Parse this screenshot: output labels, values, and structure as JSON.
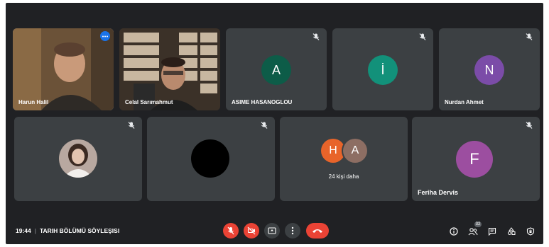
{
  "participants": [
    {
      "name": "Harun Halil",
      "type": "video"
    },
    {
      "name": "Celal Sarımahmut",
      "type": "video"
    },
    {
      "name": "ASIME HASANOGLOU",
      "initial": "A",
      "color": "#0d5c48"
    },
    {
      "name": "",
      "initial": "İ",
      "color": "#12917a"
    },
    {
      "name": "Nurdan Ahmet",
      "initial": "N",
      "color": "#7b4ca8"
    },
    {
      "name": "",
      "type": "photo"
    },
    {
      "name": "",
      "type": "black"
    },
    {
      "name": "Feriha Dervis",
      "initial": "F",
      "color": "#9c4ea0"
    }
  ],
  "more_tile": {
    "label": "24 kişi daha",
    "avatars": [
      {
        "initial": "H",
        "color": "#e8642a"
      },
      {
        "initial": "A",
        "color": "#8d6e63"
      }
    ]
  },
  "meeting": {
    "time": "19:44",
    "separator": "|",
    "title": "TARIH BÖLÜMÜ SÖYLEŞISI"
  },
  "people_count": "32",
  "colors": {
    "background": "#202124",
    "tile": "#3c4043",
    "danger": "#ea4335",
    "active_border": "#8ab4f8"
  }
}
